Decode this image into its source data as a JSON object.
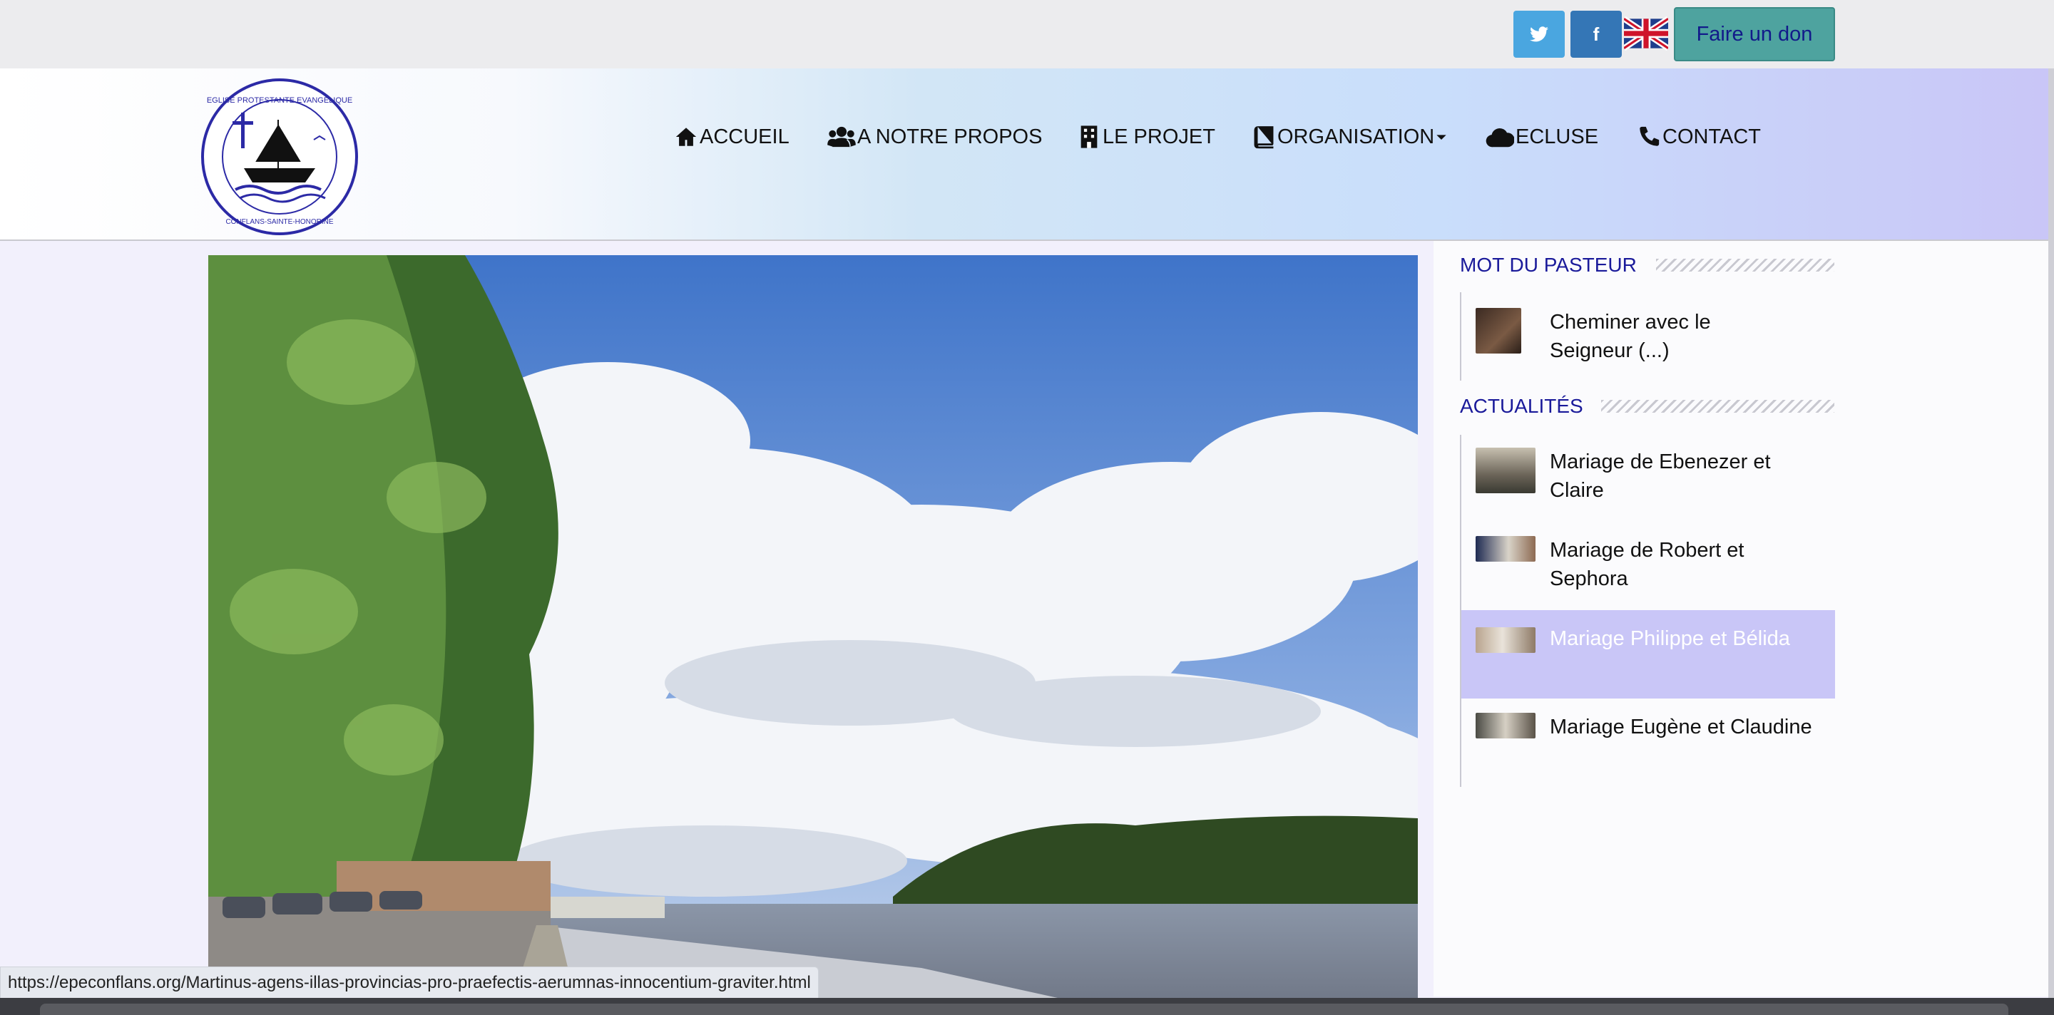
{
  "topbar": {
    "twitter_icon": "t",
    "facebook_icon": "f",
    "language_flag": "uk-flag-icon",
    "donate_label": "Faire un don"
  },
  "header": {
    "logo_text_top": "EGLISE PROTESTANTE EVANGELIQUE",
    "logo_text_bottom": "CONFLANS-SAINTE-HONORINE",
    "nav": [
      {
        "label": "ACCUEIL",
        "icon": "home-icon"
      },
      {
        "label": "A NOTRE PROPOS",
        "icon": "users-icon"
      },
      {
        "label": "LE PROJET",
        "icon": "building-icon"
      },
      {
        "label": "ORGANISATION",
        "icon": "book-icon"
      },
      {
        "label": "ECLUSE",
        "icon": "cloud-icon"
      },
      {
        "label": "CONTACT",
        "icon": "phone-icon"
      }
    ]
  },
  "sidebar": {
    "pastor_title": "MOT DU PASTEUR",
    "pastor_items": [
      {
        "line1": "Cheminer avec le",
        "line2": "Seigneur (...)"
      }
    ],
    "news_title": "ACTUALITÉS",
    "news_items": [
      {
        "line1": "Mariage de Ebenezer et",
        "line2": "Claire"
      },
      {
        "line1": "Mariage de Robert et Sephora",
        "line2": ""
      },
      {
        "line1": "Mariage Philippe et Bélida",
        "line2": ""
      },
      {
        "line1": "Mariage Eugène et Claudine",
        "line2": ""
      }
    ]
  },
  "status_bar": {
    "url": "https://epeconflans.org/Martinus-agens-illas-provincias-pro-praefectis-aerumnas-innocentium-graviter.html"
  },
  "colors": {
    "accent_lavender": "#c9c6f7",
    "donate_green": "#4ea39f",
    "section_title_blue": "#1a1a9a"
  }
}
